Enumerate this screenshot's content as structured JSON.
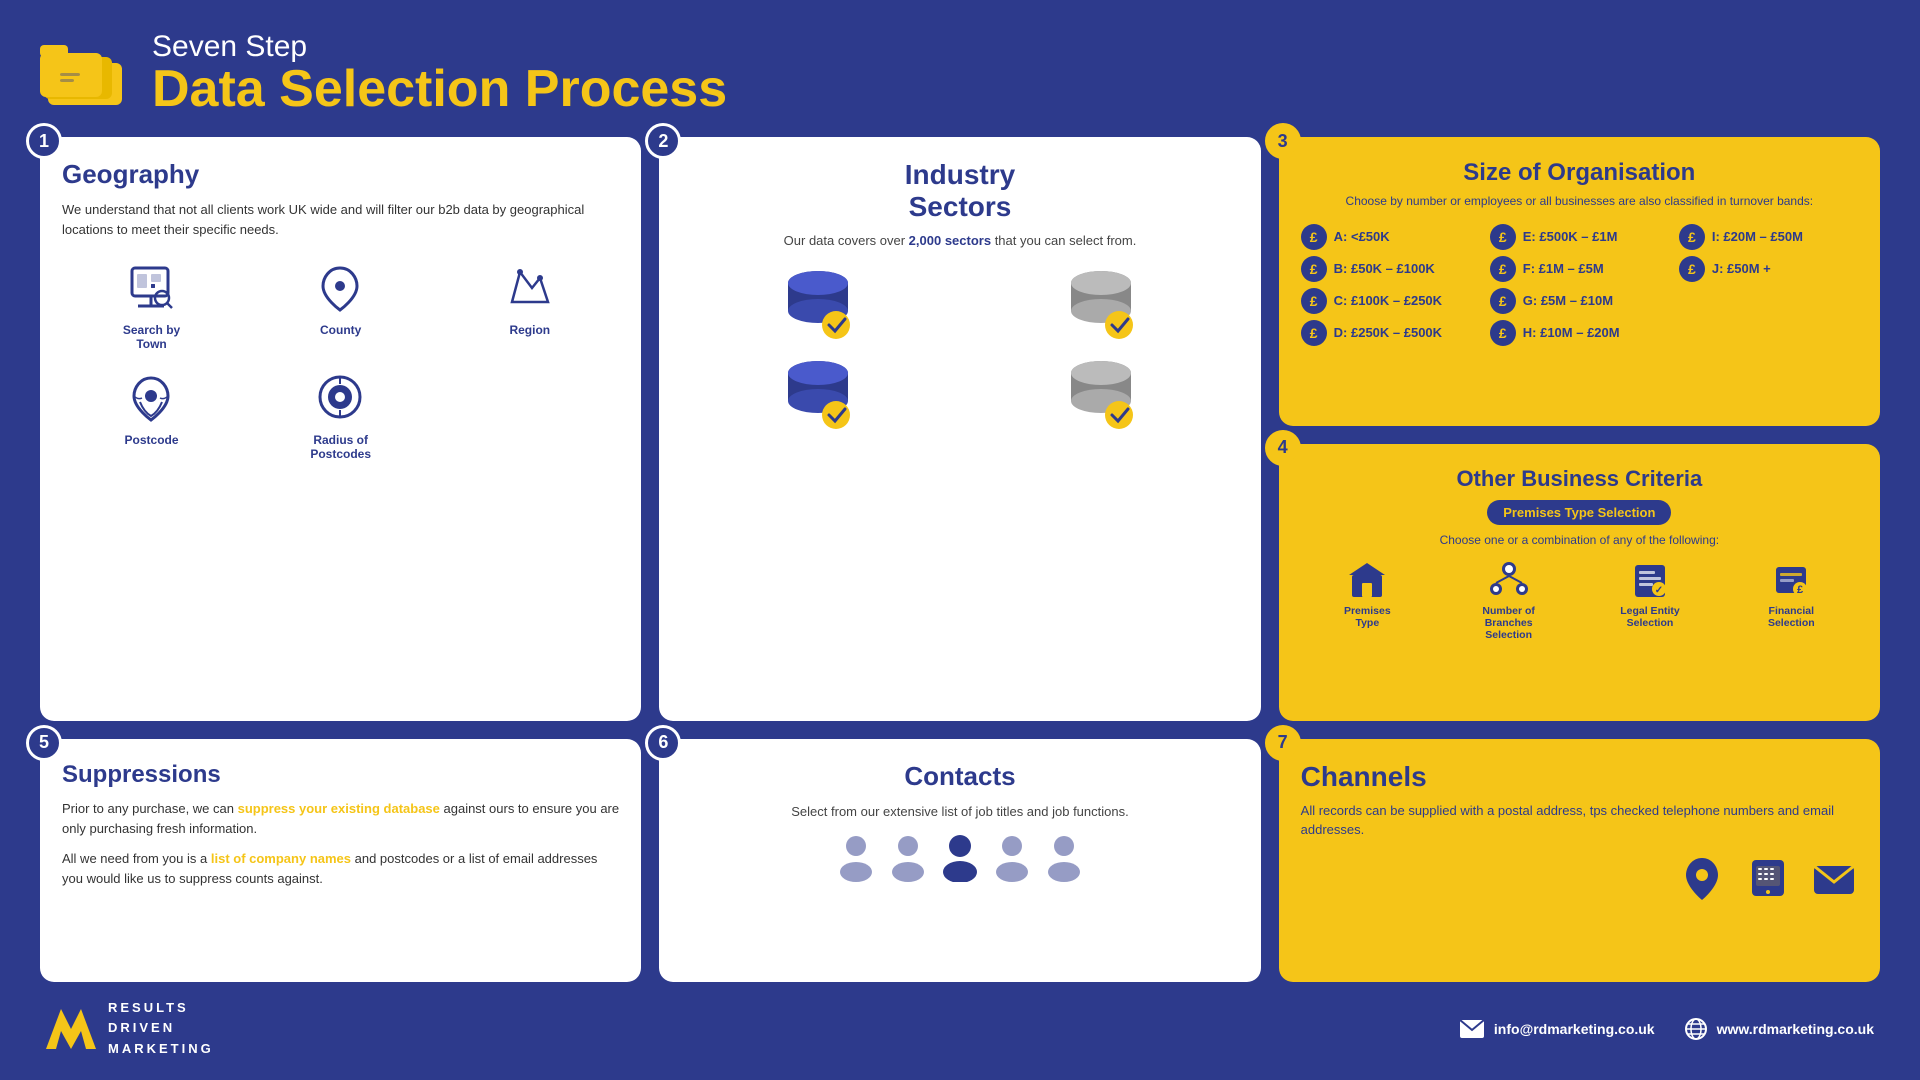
{
  "header": {
    "subtitle": "Seven Step",
    "title": "Data Selection Process"
  },
  "step1": {
    "badge": "1",
    "title": "Geography",
    "description": "We understand that not all clients work UK wide and will filter our b2b data by geographical locations to meet their specific needs.",
    "icons": [
      {
        "label": "Search by Town",
        "name": "search-by-town-icon"
      },
      {
        "label": "County",
        "name": "county-icon"
      },
      {
        "label": "Region",
        "name": "region-icon"
      },
      {
        "label": "Postcode",
        "name": "postcode-icon"
      },
      {
        "label": "Radius of Postcodes",
        "name": "radius-icon"
      }
    ]
  },
  "step2": {
    "badge": "2",
    "title": "Industry Sectors",
    "description": "Our data covers over 2,000 sectors that you can select from.",
    "highlight": "2,000"
  },
  "step3": {
    "badge": "3",
    "title": "Size of Organisation",
    "subtitle": "Choose by number or employees or all businesses are also classified in turnover bands:",
    "items": [
      {
        "label": "A: <£50K"
      },
      {
        "label": "E: £500K – £1M"
      },
      {
        "label": "I: £20M – £50M"
      },
      {
        "label": "B: £50K – £100K"
      },
      {
        "label": "F: £1M – £5M"
      },
      {
        "label": "J: £50M +"
      },
      {
        "label": "C: £100K – £250K"
      },
      {
        "label": "G: £5M – £10M"
      },
      {
        "label": ""
      },
      {
        "label": "D: £250K – £500K"
      },
      {
        "label": "H: £10M – £20M"
      },
      {
        "label": ""
      }
    ]
  },
  "step4": {
    "badge": "4",
    "title": "Other Business Criteria",
    "badge_label": "Premises Type Selection",
    "description": "Choose one or a combination of any of the following:",
    "icons": [
      {
        "label": "Premises Type"
      },
      {
        "label": "Number of Branches Selection"
      },
      {
        "label": "Legal Entity Selection"
      },
      {
        "label": "Financial Selection"
      }
    ]
  },
  "step5": {
    "badge": "5",
    "title": "Suppressions",
    "para1_plain": "Prior to any purchase, we can ",
    "para1_highlight": "suppress your existing database",
    "para1_end": " against ours to ensure you are only purchasing fresh information.",
    "para2_plain": "All we need from you is a ",
    "para2_highlight": "list of company names",
    "para2_end": " and postcodes or a list of email addresses you would like us to suppress counts against."
  },
  "step6": {
    "badge": "6",
    "title": "Contacts",
    "description": "Select from our extensive list of job titles and job functions."
  },
  "step7": {
    "badge": "7",
    "title": "Channels",
    "description": "All records can be supplied with a postal address, tps checked telephone numbers and email addresses."
  },
  "footer": {
    "logo_line1": "RESULTS",
    "logo_line2": "DRIVEN",
    "logo_line3": "MARKETING",
    "email": "info@rdmarketing.co.uk",
    "website": "www.rdmarketing.co.uk"
  }
}
